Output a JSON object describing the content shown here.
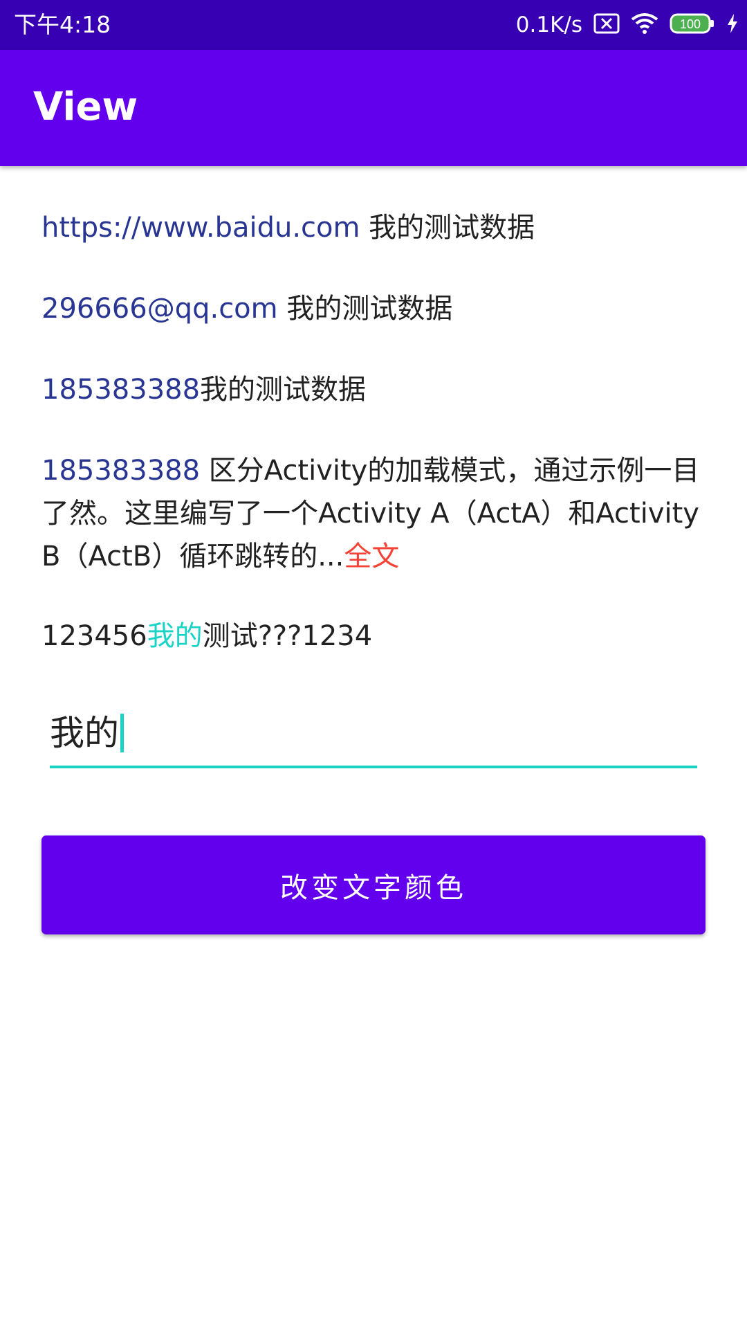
{
  "status_bar": {
    "time": "下午4:18",
    "net_speed": "0.1K/s",
    "battery": "100",
    "icons": [
      "no-sim-icon",
      "wifi-icon",
      "battery-icon",
      "charging-icon"
    ]
  },
  "app_bar": {
    "title": "View"
  },
  "rows": {
    "row1": {
      "link": "https://www.baidu.com",
      "text": " 我的测试数据"
    },
    "row2": {
      "link": "296666@qq.com",
      "text": " 我的测试数据"
    },
    "row3": {
      "link": "185383388",
      "text": "我的测试数据"
    },
    "row4": {
      "link": "185383388",
      "text": " 区分Activity的加载模式，通过示例一目了然。这里编写了一个Activity A（ActA）和Activity B（ActB）循环跳转的...",
      "more": "全文"
    },
    "row5": {
      "prefix": "123456",
      "highlight": "我的",
      "suffix": "测试???1234"
    }
  },
  "input": {
    "value": "我的"
  },
  "button": {
    "label": "改变文字颜色"
  },
  "colors": {
    "status_bar": "#3700b3",
    "app_bar": "#6200ee",
    "link": "#283593",
    "more_link": "#f44336",
    "highlight": "#1ad3c6",
    "button": "#6200ee"
  }
}
